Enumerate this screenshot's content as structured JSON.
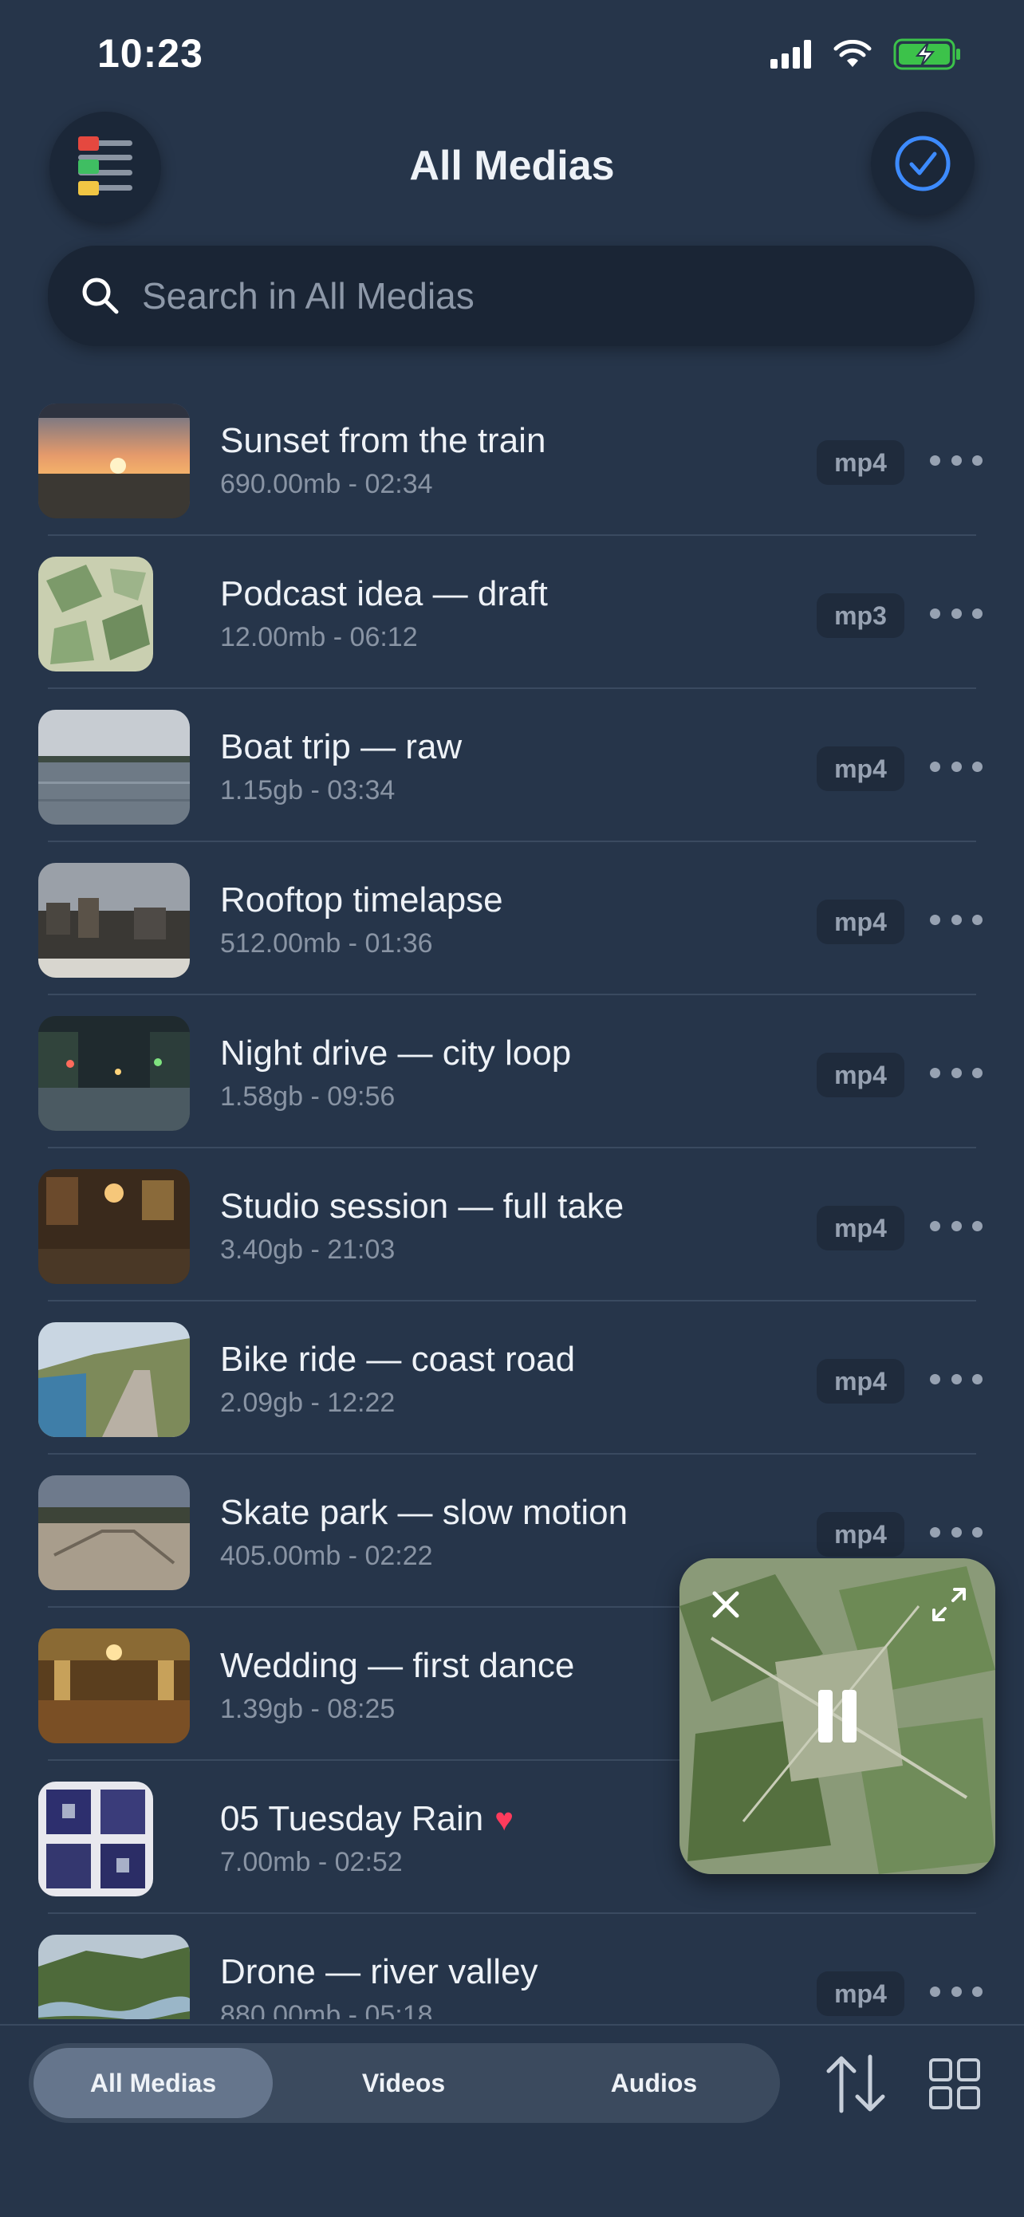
{
  "status_bar": {
    "time": "10:23"
  },
  "header": {
    "title": "All Medias"
  },
  "search": {
    "placeholder": "Search in All Medias"
  },
  "colors": {
    "background": "#26354a",
    "accent": "#3d8bff",
    "heart": "#ff3b5c",
    "battery": "#3cc24a"
  },
  "media_items": [
    {
      "title": "Sunset from the train",
      "meta": "690.00mb - 02:34",
      "format": "mp4",
      "thumb_icon": "sunset-thumbnail"
    },
    {
      "title": "Podcast idea — draft",
      "meta": "12.00mb - 06:12",
      "format": "mp3",
      "thumb_icon": "leaf-pattern-thumbnail"
    },
    {
      "title": "Boat trip — raw",
      "meta": "1.15gb - 03:34",
      "format": "mp4",
      "thumb_icon": "lake-thumbnail"
    },
    {
      "title": "Rooftop timelapse",
      "meta": "512.00mb - 01:36",
      "format": "mp4",
      "thumb_icon": "city-rooftop-thumbnail"
    },
    {
      "title": "Night drive — city loop",
      "meta": "1.58gb - 09:56",
      "format": "mp4",
      "thumb_icon": "night-street-thumbnail"
    },
    {
      "title": "Studio session — full take",
      "meta": "3.40gb - 21:03",
      "format": "mp4",
      "thumb_icon": "studio-room-thumbnail"
    },
    {
      "title": "Bike ride — coast road",
      "meta": "2.09gb - 12:22",
      "format": "mp4",
      "thumb_icon": "coast-road-thumbnail"
    },
    {
      "title": "Skate park — slow motion",
      "meta": "405.00mb - 02:22",
      "format": "mp4",
      "thumb_icon": "skate-park-thumbnail"
    },
    {
      "title": "Wedding — first dance",
      "meta": "1.39gb - 08:25",
      "format": "",
      "thumb_icon": "ballroom-thumbnail"
    },
    {
      "title": "05 Tuesday Rain",
      "meta": "7.00mb - 02:52",
      "format": "",
      "favorite": true,
      "thumb_icon": "album-art-thumbnail"
    },
    {
      "title": "Drone — river valley",
      "meta": "880.00mb - 05:18",
      "format": "mp4",
      "thumb_icon": "river-valley-thumbnail"
    }
  ],
  "mini_player": {
    "state": "playing",
    "icons": [
      "close-icon",
      "expand-icon",
      "pause-icon"
    ]
  },
  "tabs": [
    {
      "label": "All Medias",
      "active": true
    },
    {
      "label": "Videos",
      "active": false
    },
    {
      "label": "Audios",
      "active": false
    }
  ],
  "toolbar_icons": [
    "sort-icon",
    "grid-view-icon"
  ]
}
